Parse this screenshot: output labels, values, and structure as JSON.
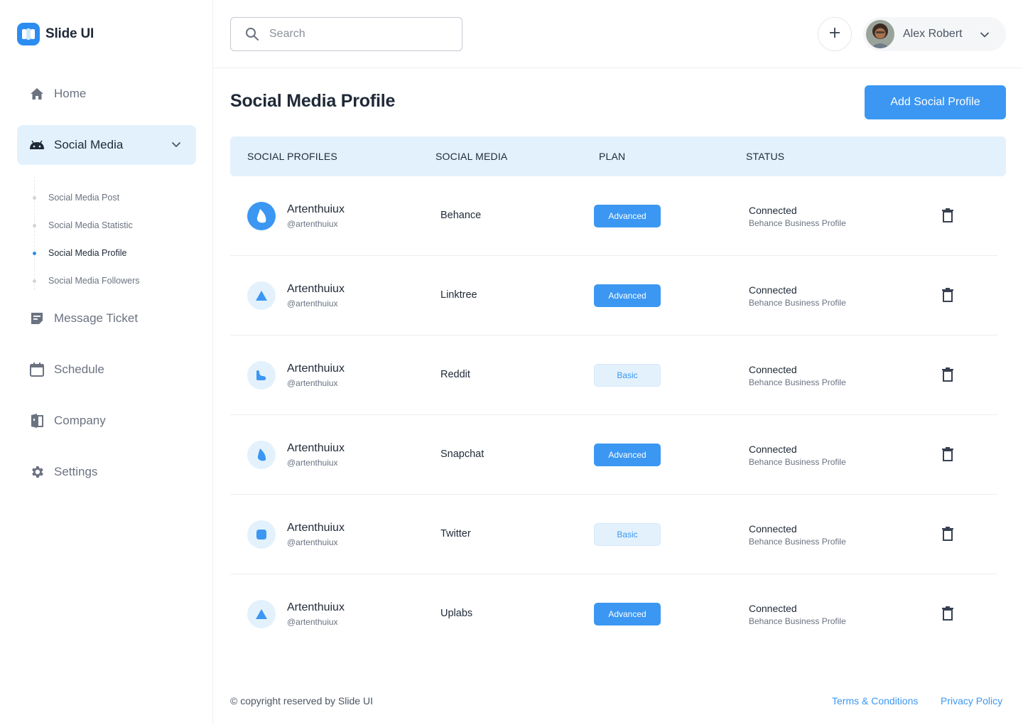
{
  "app": {
    "name": "Slide UI"
  },
  "sidebar": {
    "items": [
      {
        "label": "Home",
        "icon": "home-icon"
      },
      {
        "label": "Social Media",
        "icon": "android-icon",
        "active": true
      },
      {
        "label": "Message Ticket",
        "icon": "message-icon"
      },
      {
        "label": "Schedule",
        "icon": "calendar-icon"
      },
      {
        "label": "Company",
        "icon": "company-icon"
      },
      {
        "label": "Settings",
        "icon": "gear-icon"
      }
    ],
    "subitems": [
      {
        "label": "Social Media Post"
      },
      {
        "label": "Social Media Statistic"
      },
      {
        "label": "Social Media Profile",
        "active": true
      },
      {
        "label": "Social Media Followers"
      }
    ]
  },
  "topbar": {
    "search_placeholder": "Search",
    "user_name": "Alex Robert"
  },
  "main": {
    "title": "Social Media Profile",
    "add_button": "Add Social Profile",
    "columns": [
      "SOCIAL PROFILES",
      "SOCIAL MEDIA",
      "PLAN",
      "STATUS"
    ],
    "rows": [
      {
        "name": "Artenthuiux",
        "handle": "@artenthuiux",
        "media": "Behance",
        "plan": "Advanced",
        "status": "Connected",
        "status_detail": "Behance Business Profile"
      },
      {
        "name": "Artenthuiux",
        "handle": "@artenthuiux",
        "media": "Linktree",
        "plan": "Advanced",
        "status": "Connected",
        "status_detail": "Behance Business Profile"
      },
      {
        "name": "Artenthuiux",
        "handle": "@artenthuiux",
        "media": "Reddit",
        "plan": "Basic",
        "status": "Connected",
        "status_detail": "Behance Business Profile"
      },
      {
        "name": "Artenthuiux",
        "handle": "@artenthuiux",
        "media": "Snapchat",
        "plan": "Advanced",
        "status": "Connected",
        "status_detail": "Behance Business Profile"
      },
      {
        "name": "Artenthuiux",
        "handle": "@artenthuiux",
        "media": "Twitter",
        "plan": "Basic",
        "status": "Connected",
        "status_detail": "Behance Business Profile"
      },
      {
        "name": "Artenthuiux",
        "handle": "@artenthuiux",
        "media": "Uplabs",
        "plan": "Advanced",
        "status": "Connected",
        "status_detail": "Behance Business Profile"
      }
    ]
  },
  "footer": {
    "copyright": "© copyright reserved by Slide UI",
    "terms": "Terms & Conditions",
    "privacy": "Privacy Policy"
  },
  "colors": {
    "accent": "#3b97f2",
    "accent_light": "#e3f1fc"
  }
}
